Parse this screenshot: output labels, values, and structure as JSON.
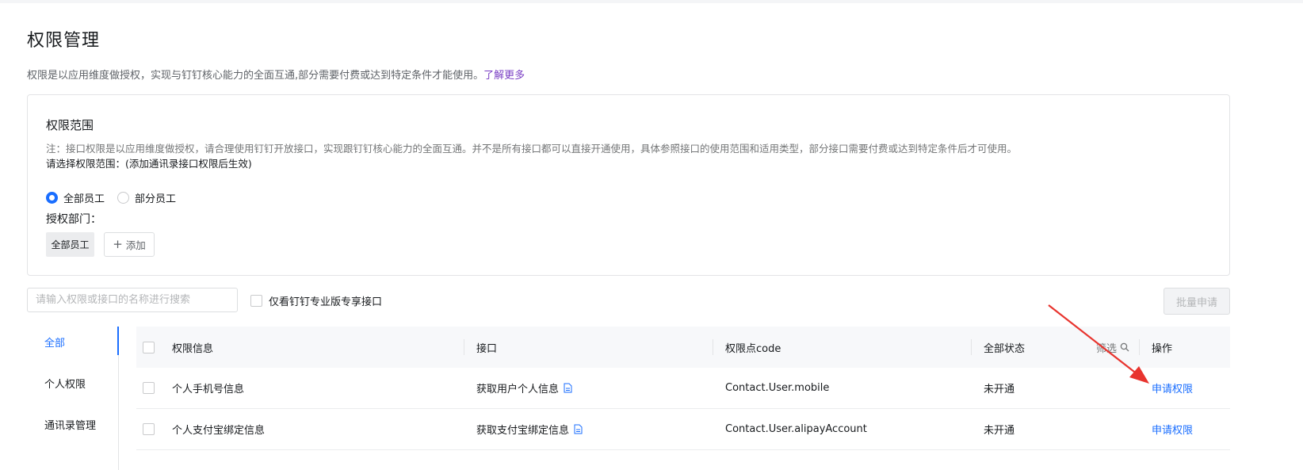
{
  "page": {
    "title": "权限管理",
    "description": "权限是以应用维度做授权，实现与钉钉核心能力的全面互通,部分需要付费或达到特定条件才能使用。",
    "learn_more": "了解更多"
  },
  "scope": {
    "title": "权限范围",
    "note": "注：接口权限是以应用维度做授权，请合理使用钉钉开放接口，实现跟钉钉核心能力的全面互通。并不是所有接口都可以直接开通使用，具体参照接口的使用范围和适用类型，部分接口需要付费或达到特定条件后才可使用。",
    "choose": "请选择权限范围：(添加通讯录接口权限后生效)",
    "options": [
      "全部员工",
      "部分员工"
    ],
    "selected": "全部员工",
    "dept_label": "授权部门：",
    "dept_tag": "全部员工",
    "add_label": "添加"
  },
  "toolbar": {
    "search_placeholder": "请输入权限或接口的名称进行搜索",
    "only_pro_label": "仅看钉钉专业版专享接口",
    "batch_label": "批量申请"
  },
  "side_nav": {
    "items": [
      "全部",
      "个人权限",
      "通讯录管理"
    ],
    "active": "全部"
  },
  "table": {
    "columns": {
      "info": "权限信息",
      "api": "接口",
      "code": "权限点code",
      "status": "全部状态",
      "filter": "筛选",
      "op": "操作"
    },
    "rows": [
      {
        "info": "个人手机号信息",
        "api": "获取用户个人信息",
        "code": "Contact.User.mobile",
        "status": "未开通",
        "op": "申请权限"
      },
      {
        "info": "个人支付宝绑定信息",
        "api": "获取支付宝绑定信息",
        "code": "Contact.User.alipayAccount",
        "status": "未开通",
        "op": "申请权限"
      }
    ]
  },
  "colors": {
    "primary": "#1a6eff",
    "link_purple": "#7a3fc4",
    "annotation_arrow": "#e8342e"
  }
}
